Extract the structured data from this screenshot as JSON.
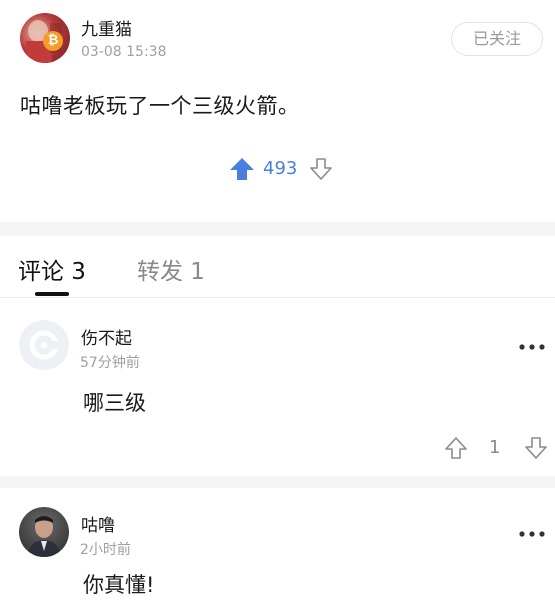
{
  "post": {
    "author": "九重猫",
    "time": "03-08 15:38",
    "follow_label": "已关注",
    "content": "咕噜老板玩了一个三级火箭。",
    "votes": "493",
    "badge_glyph": "₿",
    "accent_color": "#4a7fe0"
  },
  "tabs": {
    "comments": "评论 3",
    "reposts": "转发 1"
  },
  "comments": [
    {
      "author": "伤不起",
      "time": "57分钟前",
      "text": "哪三级",
      "votes": "1"
    },
    {
      "author": "咕噜",
      "time": "2小时前",
      "text": "你真懂!"
    }
  ]
}
